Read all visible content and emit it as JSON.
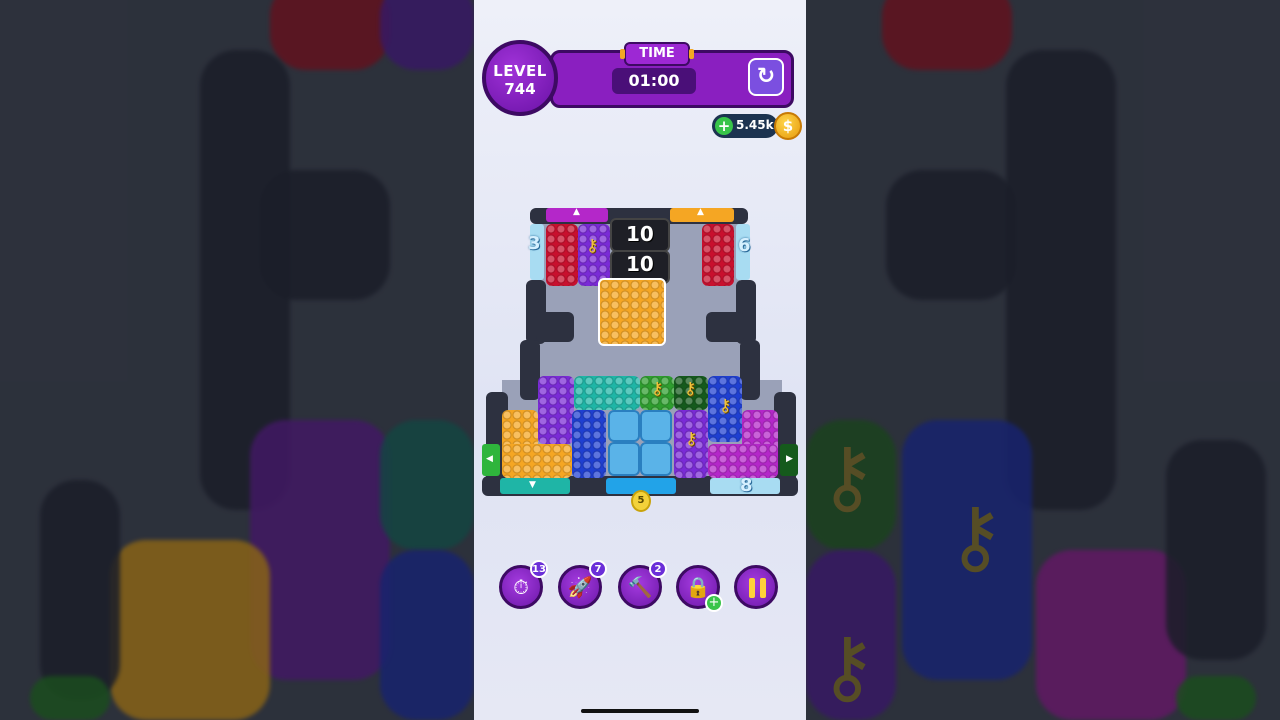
{
  "hud": {
    "level_label": "LEVEL",
    "level_number": "744",
    "time_label": "TIME",
    "time_value": "01:00",
    "restart_icon": "restart-icon",
    "coins": "5.45k",
    "coin_add_icon": "plus-icon",
    "coin_icon": "coin-icon",
    "coin_symbol": "$"
  },
  "board": {
    "chain_counts": [
      "10",
      "10"
    ],
    "gate_counts": {
      "left_top": "3",
      "right_top": "6",
      "bottom_right": "8"
    },
    "lock_count": "5"
  },
  "boosters": [
    {
      "name": "freeze-timer",
      "icon": "clock-icon",
      "count": "13"
    },
    {
      "name": "rocket",
      "icon": "rocket-icon",
      "count": "7"
    },
    {
      "name": "hammer",
      "icon": "hammer-icon",
      "count": "2"
    },
    {
      "name": "unlock",
      "icon": "lock-icon",
      "count": "+"
    }
  ],
  "colors": {
    "hud_purple": "#8a1fc0",
    "red": "#c8102e",
    "purple": "#7a2bd6",
    "orange": "#f5a623",
    "blue": "#1f3fd1",
    "teal": "#1fb5a6",
    "green": "#2e9e2e",
    "magenta": "#b427c9"
  }
}
